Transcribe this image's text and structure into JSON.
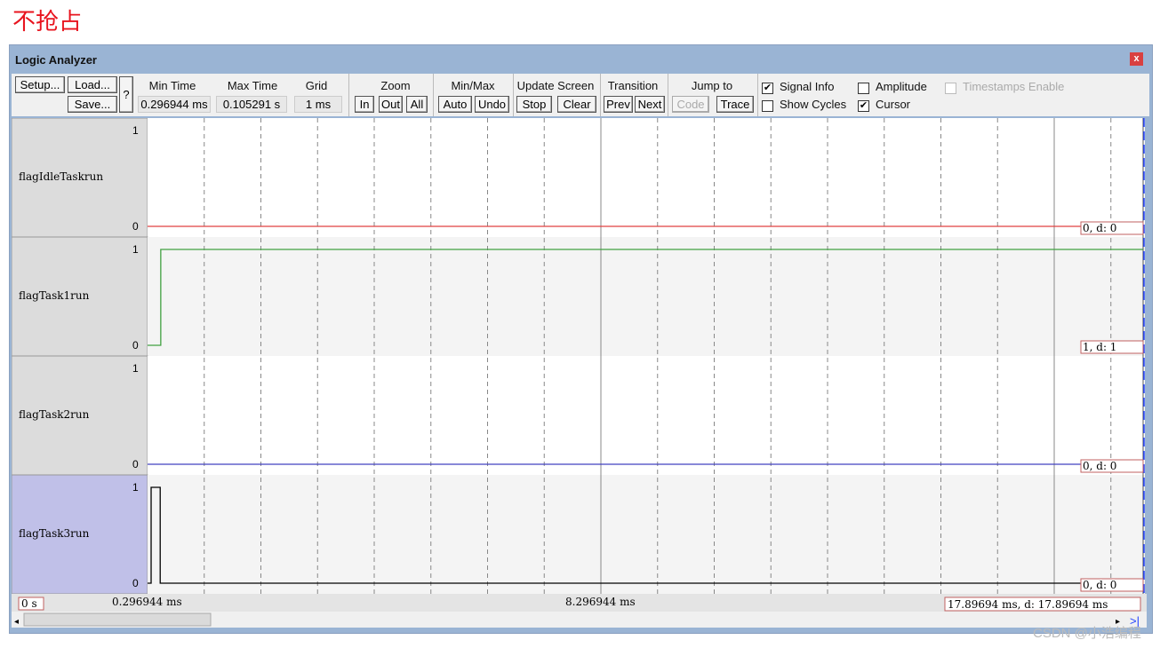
{
  "caption": "不抢占",
  "window": {
    "title": "Logic Analyzer",
    "close": "x"
  },
  "toolbar": {
    "setup": "Setup...",
    "load": "Load...",
    "save": "Save...",
    "help": "?",
    "min_time_label": "Min Time",
    "min_time": "0.296944 ms",
    "max_time_label": "Max Time",
    "max_time": "0.105291 s",
    "grid_label": "Grid",
    "grid": "1 ms",
    "zoom_label": "Zoom",
    "zoom_in": "In",
    "zoom_out": "Out",
    "zoom_all": "All",
    "minmax_label": "Min/Max",
    "auto": "Auto",
    "undo": "Undo",
    "update_label": "Update Screen",
    "stop": "Stop",
    "clear": "Clear",
    "transition_label": "Transition",
    "prev": "Prev",
    "next": "Next",
    "jump_label": "Jump to",
    "code": "Code",
    "trace": "Trace",
    "checkboxes": [
      {
        "label": "Signal Info",
        "checked": true,
        "enabled": true
      },
      {
        "label": "Amplitude",
        "checked": false,
        "enabled": true
      },
      {
        "label": "Timestamps Enable",
        "checked": false,
        "enabled": false
      },
      {
        "label": "Show Cycles",
        "checked": false,
        "enabled": true
      },
      {
        "label": "Cursor",
        "checked": true,
        "enabled": true
      }
    ]
  },
  "signals": [
    {
      "name": "flagIdleTaskrun",
      "high": "1",
      "low": "0",
      "color": "#e04040",
      "info": "0,   d: 0",
      "transitions": [
        [
          0.296944,
          0
        ]
      ]
    },
    {
      "name": "flagTask1run",
      "high": "1",
      "low": "0",
      "color": "#40a040",
      "info": "1,   d: 1",
      "transitions": [
        [
          0.296944,
          0
        ],
        [
          0.53,
          1
        ]
      ]
    },
    {
      "name": "flagTask2run",
      "high": "1",
      "low": "0",
      "color": "#4040c0",
      "info": "0,   d: 0",
      "transitions": [
        [
          0.296944,
          0
        ]
      ]
    },
    {
      "name": "flagTask3run",
      "high": "1",
      "low": "0",
      "color": "#000000",
      "info": "0,   d: 0",
      "selected": true,
      "transitions": [
        [
          0.296944,
          0
        ],
        [
          0.36,
          1
        ],
        [
          0.52,
          0
        ]
      ]
    }
  ],
  "time_axis": {
    "start_label": "0 s",
    "left": "0.296944 ms",
    "center": "8.296944 ms",
    "cursor": "17.89694 ms,   d: 17.89694 ms",
    "min_ms": 0.296944,
    "max_ms": 17.89694,
    "grid_ms": 1,
    "cursor_ms": 17.89694
  },
  "watermark": "CSDN @小浩编程"
}
